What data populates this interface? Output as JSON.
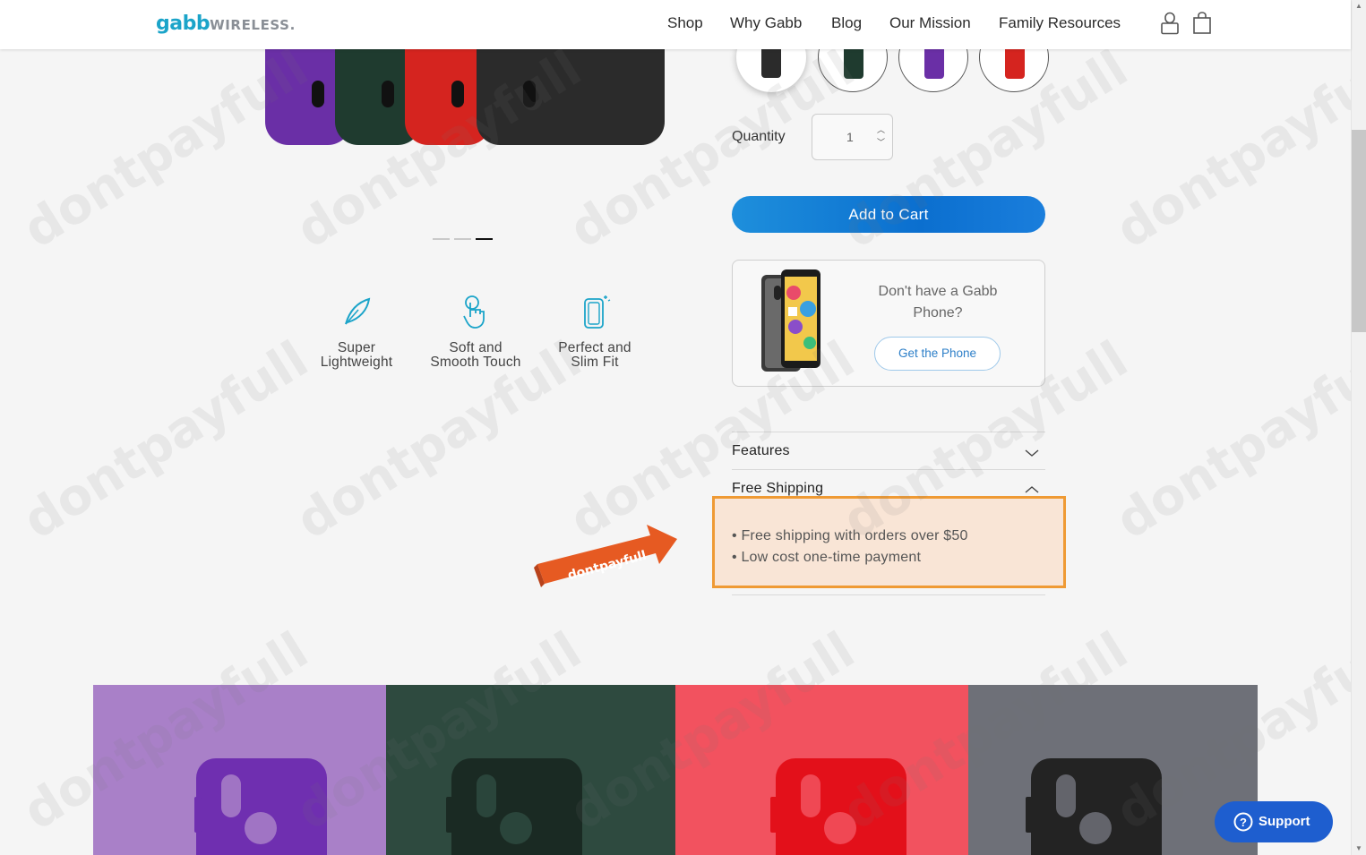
{
  "header": {
    "logo_main": "gabb",
    "logo_sub": "WIRELESS",
    "logo_mark": ".",
    "nav": [
      "Shop",
      "Why Gabb",
      "Blog",
      "Our Mission",
      "Family Resources"
    ],
    "account_icon": "user-icon",
    "cart_icon": "shopping-bag-icon"
  },
  "gallery": {
    "colors": [
      "#6a2fa6",
      "#1f3b2f",
      "#d5241f",
      "#2b2b2b"
    ],
    "active_slide": 3,
    "slide_count": 3
  },
  "features": [
    {
      "icon": "feather-icon",
      "label_line1": "Super",
      "label_line2": "Lightweight"
    },
    {
      "icon": "touch-hand-icon",
      "label_line1": "Soft and",
      "label_line2": "Smooth Touch"
    },
    {
      "icon": "phone-fit-icon",
      "label_line1": "Perfect and",
      "label_line2": "Slim Fit"
    }
  ],
  "swatches": [
    {
      "name": "black",
      "color": "#2b2b2b",
      "selected": true
    },
    {
      "name": "green",
      "color": "#1f3b2f",
      "selected": false
    },
    {
      "name": "purple",
      "color": "#6a2fa6",
      "selected": false
    },
    {
      "name": "red",
      "color": "#d5241f",
      "selected": false
    }
  ],
  "quantity": {
    "label": "Quantity",
    "value": "1"
  },
  "add_to_cart": "Add to Cart",
  "promo": {
    "text": "Don't have a Gabb Phone?",
    "button": "Get the Phone"
  },
  "accordion": {
    "features_title": "Features",
    "shipping_title": "Free Shipping",
    "shipping_items": [
      "• Free shipping with orders over $50",
      "• Low cost one-time payment"
    ]
  },
  "ribbon_text": "dontpayfull",
  "watermark_text": "dontpayfull",
  "banner": {
    "panels": [
      {
        "bg": "#a980c8",
        "case": "#6f2fb0"
      },
      {
        "bg": "#2e4a3f",
        "case": "#1a2a23"
      },
      {
        "bg": "#f2525f",
        "case": "#e3101a"
      },
      {
        "bg": "#6e7078",
        "case": "#232323"
      }
    ]
  },
  "support": {
    "label": "Support",
    "icon": "help-circle-icon"
  },
  "colors": {
    "brand": "#1ba4c9",
    "cta": "#0b6fcf",
    "highlight_border": "#ef9a34",
    "highlight_fill": "#f9e5d6"
  }
}
